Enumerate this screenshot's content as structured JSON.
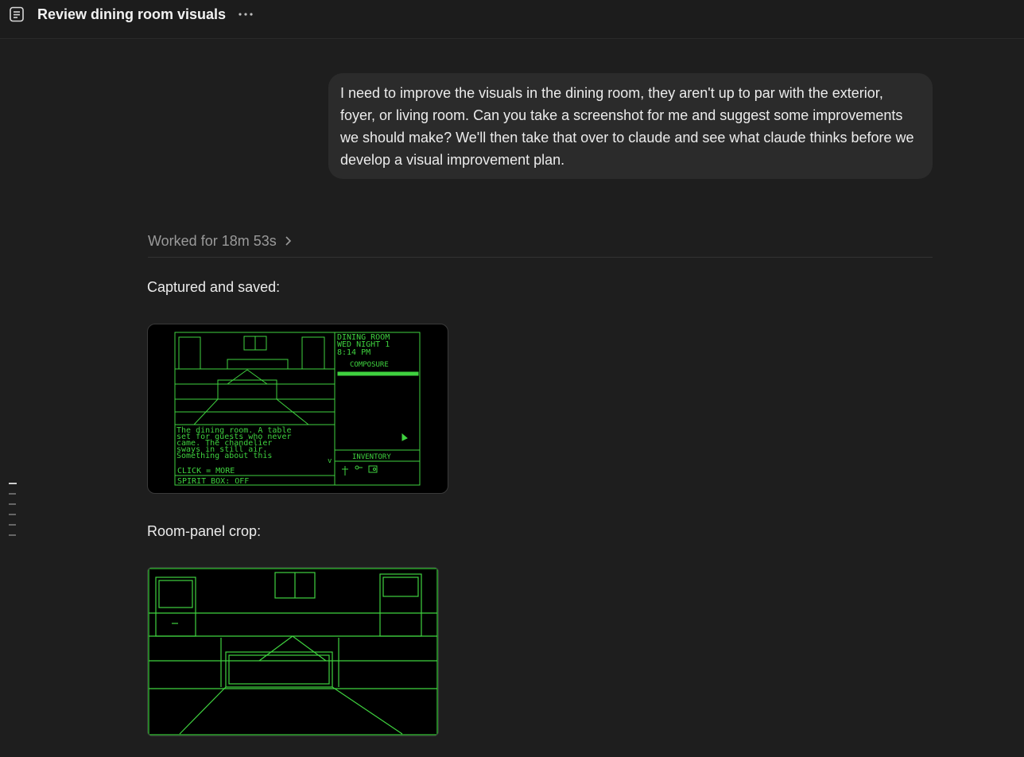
{
  "header": {
    "title": "Review dining room visuals",
    "doc_icon": "document-icon",
    "more_icon": "more-horizontal-icon"
  },
  "user_message": "I need to improve the visuals in the dining room, they aren't up to par with the exterior, foyer, or living room. Can you take a screenshot for me and suggest some improvements we should make? We'll then take that over to claude and see what claude thinks before we develop a visual improvement plan.",
  "worked": {
    "label": "Worked for 18m 53s",
    "icon": "chevron-right-icon"
  },
  "captured_label": "Captured and saved:",
  "crop_label": "Room-panel crop:",
  "game": {
    "room_name": "DINING ROOM",
    "day": "WED NIGHT 1",
    "time": "8:14 PM",
    "composure": "COMPOSURE",
    "narration": [
      "The dining room. A table",
      "set for guests who never",
      "came. The chandelier",
      "sways in still air.",
      "Something about this"
    ],
    "more_hint": "v",
    "click_hint": "CLICK = MORE",
    "spirit_box": "SPIRIT BOX: OFF",
    "inventory": "INVENTORY",
    "inventory_items": [
      "cross-icon",
      "key-icon",
      "radio-icon"
    ]
  },
  "colors": {
    "background": "#1e1e1e",
    "bubble": "#2b2b2b",
    "crt_green": "#3fd23f"
  },
  "toc": {
    "items": 6,
    "active": 0
  }
}
